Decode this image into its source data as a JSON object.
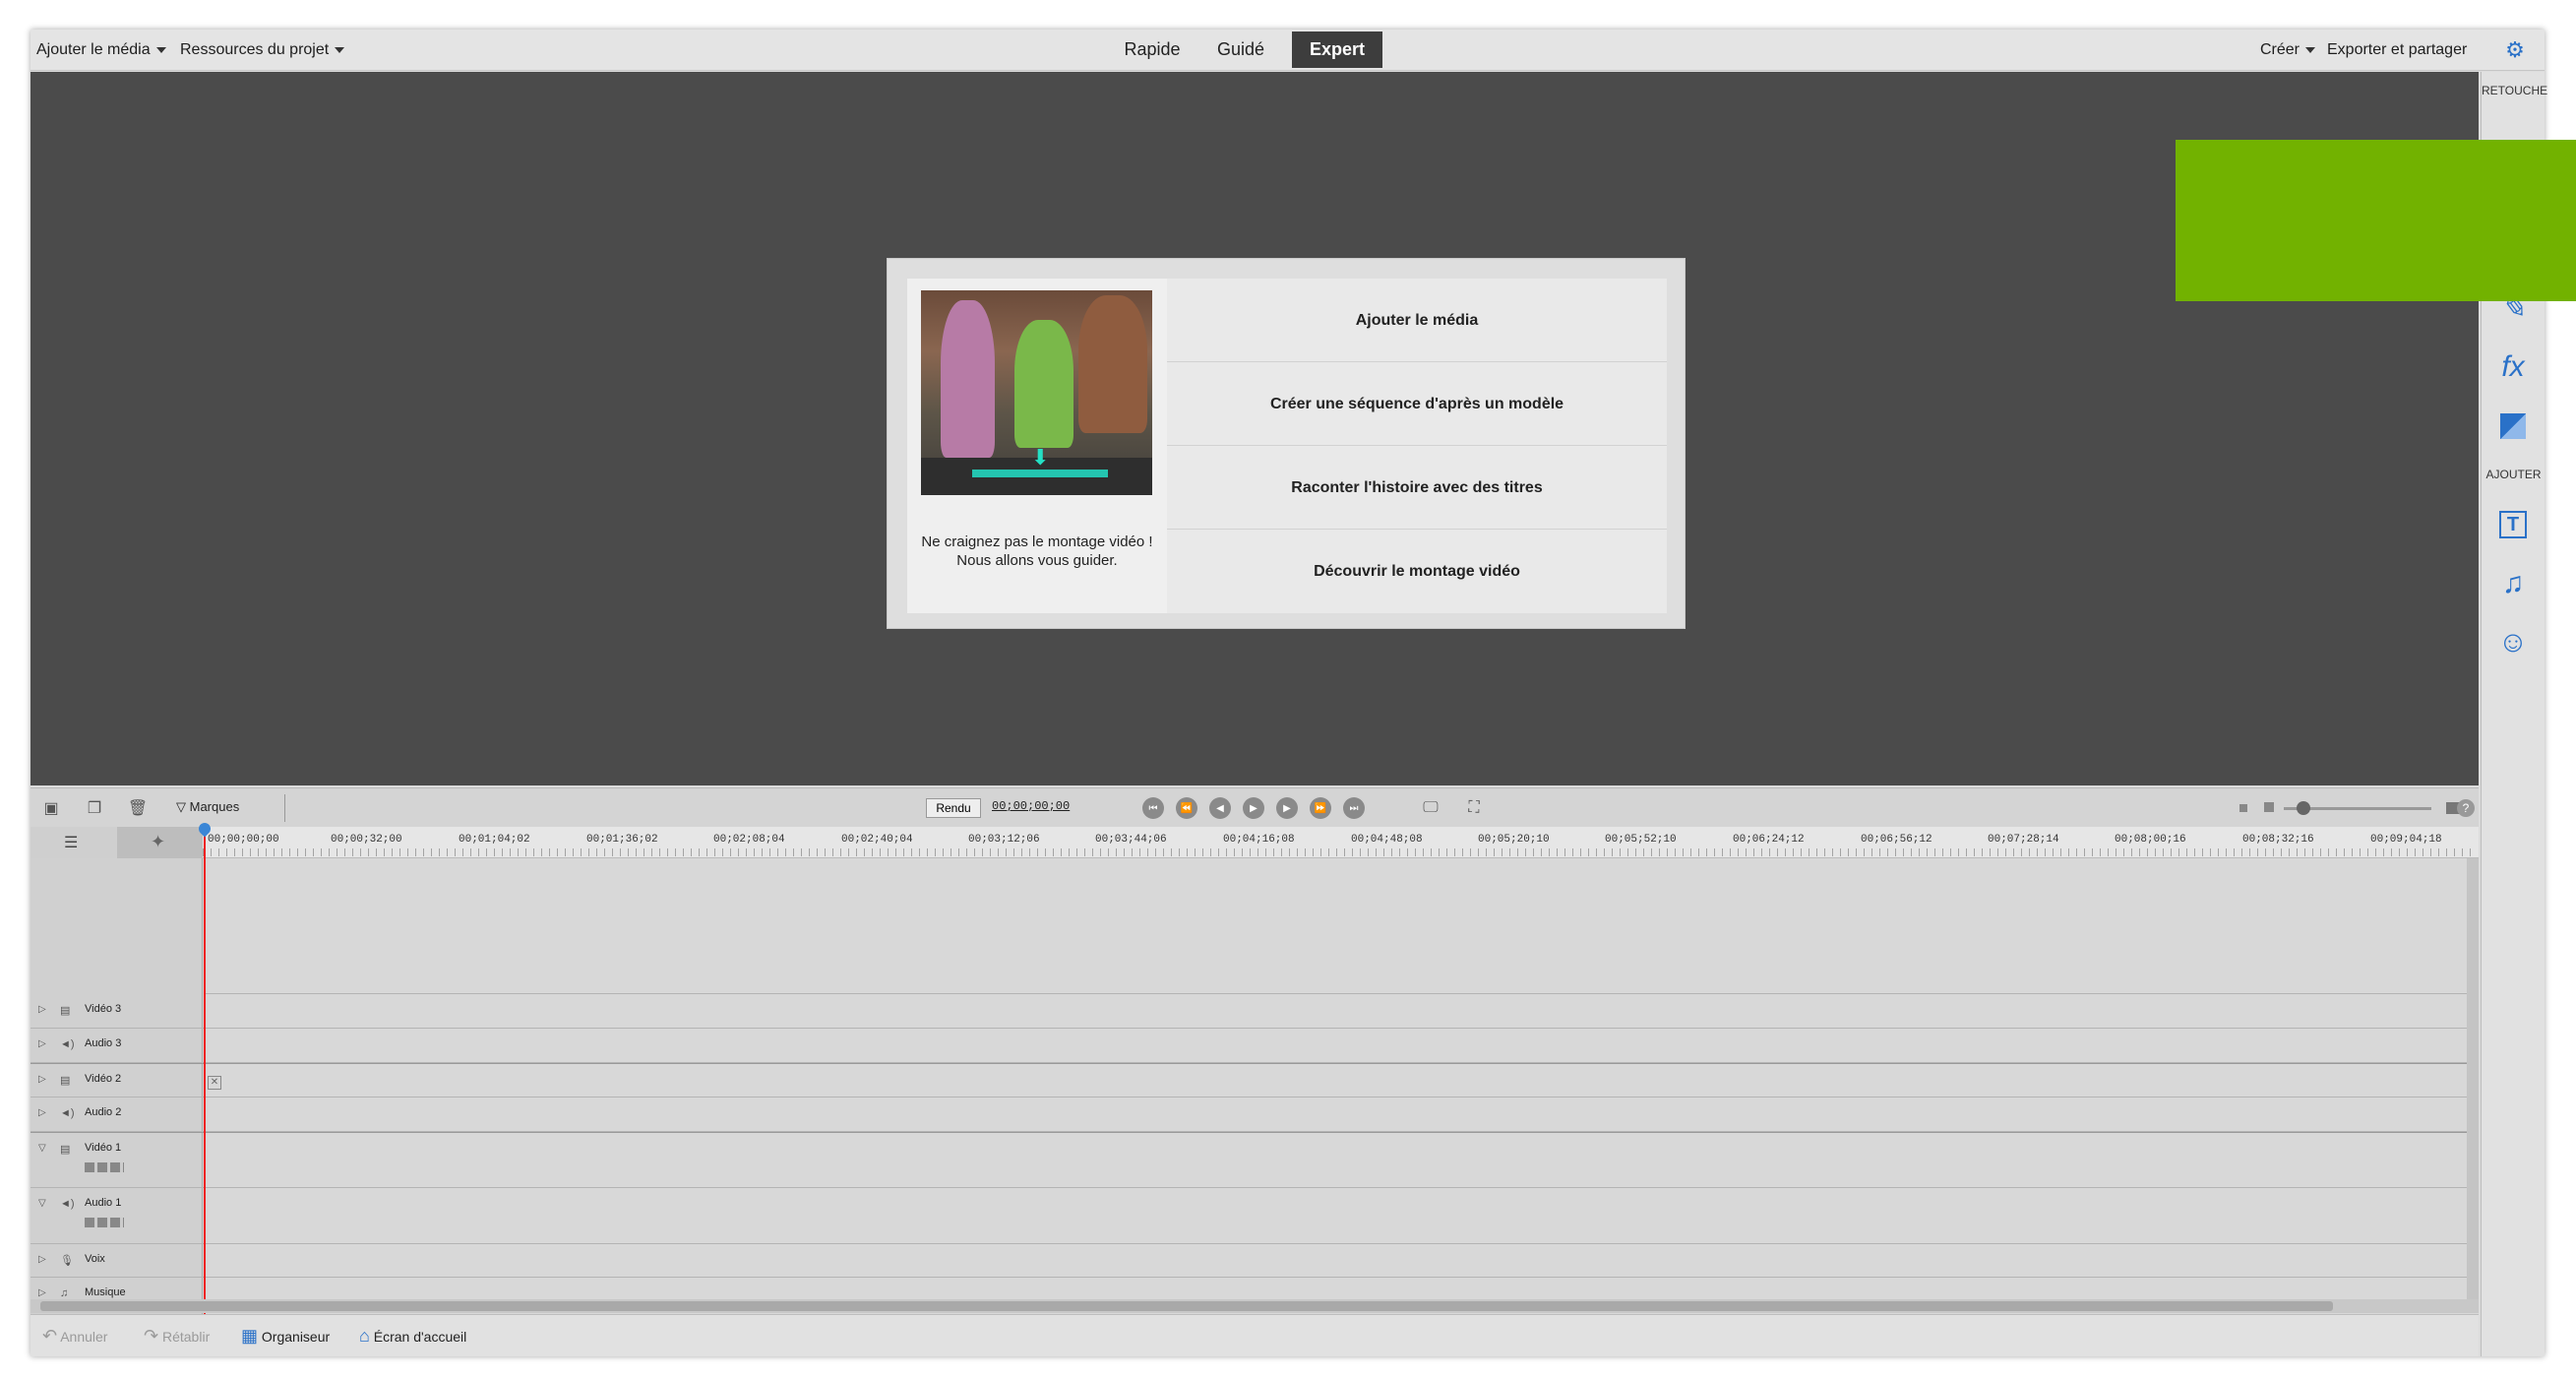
{
  "topbar": {
    "add_media": "Ajouter le média",
    "project_assets": "Ressources du projet",
    "modes": [
      "Rapide",
      "Guidé",
      "Expert"
    ],
    "active_mode": "Expert",
    "create": "Créer",
    "export_share": "Exporter et partager",
    "settings_icon": "gear-icon"
  },
  "right_panel": {
    "section_edit": "RETOUCHE",
    "section_add": "AJOUTER",
    "icons": [
      "adjust-icon",
      "fx-icon",
      "transition-icon",
      "title-icon",
      "music-icon",
      "graphics-icon"
    ],
    "fx_label": "fx"
  },
  "dialog": {
    "caption_line1": "Ne craignez pas le montage vidéo !",
    "caption_line2": "Nous allons vous guider.",
    "options": [
      "Ajouter le média",
      "Créer une séquence d'après un modèle",
      "Raconter l'histoire avec des titres",
      "Découvrir le montage vidéo"
    ]
  },
  "timeline_toolbar": {
    "markers": "Marques",
    "render": "Rendu",
    "timecode": "00;00;00;00"
  },
  "ruler": {
    "ticks": [
      "00;00;00;00",
      "00;00;32;00",
      "00;01;04;02",
      "00;01;36;02",
      "00;02;08;04",
      "00;02;40;04",
      "00;03;12;06",
      "00;03;44;06",
      "00;04;16;08",
      "00;04;48;08",
      "00;05;20;10",
      "00;05;52;10",
      "00;06;24;12",
      "00;06;56;12",
      "00;07;28;14",
      "00;08;00;16",
      "00;08;32;16",
      "00;09;04;18"
    ]
  },
  "tracks": [
    {
      "name": "Vidéo 3",
      "type": "video"
    },
    {
      "name": "Audio 3",
      "type": "audio"
    },
    {
      "name": "Vidéo 2",
      "type": "video"
    },
    {
      "name": "Audio 2",
      "type": "audio"
    },
    {
      "name": "Vidéo 1",
      "type": "video"
    },
    {
      "name": "Audio 1",
      "type": "audio"
    },
    {
      "name": "Voix",
      "type": "voice"
    },
    {
      "name": "Musique",
      "type": "music"
    }
  ],
  "bottombar": {
    "undo": "Annuler",
    "redo": "Rétablir",
    "organizer": "Organiseur",
    "home": "Écran d'accueil"
  },
  "colors": {
    "accent": "#2a71c8",
    "green_box": "#72b200",
    "playhead": "#e22222"
  }
}
